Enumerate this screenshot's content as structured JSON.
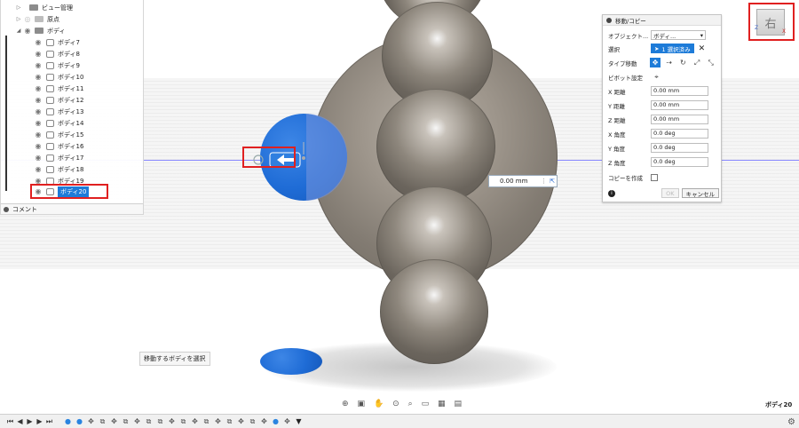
{
  "browser": {
    "view_manager": "ビュー管理",
    "origin": "原点",
    "bodies_folder": "ボディ",
    "bodies": [
      "ボディ7",
      "ボディ8",
      "ボディ9",
      "ボディ10",
      "ボディ11",
      "ボディ12",
      "ボディ13",
      "ボディ14",
      "ボディ15",
      "ボディ16",
      "ボディ17",
      "ボディ18",
      "ボディ19",
      "ボディ20"
    ],
    "selected_body": "ボディ20",
    "comment": "コメント"
  },
  "panel": {
    "title": "移動/コピー",
    "object_label": "オブジェクト...",
    "object_value": "ボディ...",
    "selection_label": "選択",
    "selection_value": "1 選択済み",
    "move_type_label": "タイプ移動",
    "pivot_label": "ピボット設定",
    "x_distance_label": "X 距離",
    "x_distance": "0.00 mm",
    "y_distance_label": "Y 距離",
    "y_distance": "0.00 mm",
    "z_distance_label": "Z 距離",
    "z_distance": "0.00 mm",
    "x_angle_label": "X 角度",
    "x_angle": "0.0 deg",
    "y_angle_label": "Y 角度",
    "y_angle": "0.0 deg",
    "z_angle_label": "Z 角度",
    "z_angle": "0.0 deg",
    "copy_label": "コピーを作成",
    "ok": "OK",
    "cancel": "キャンセル"
  },
  "viewport": {
    "distance_value": "0.00 mm",
    "status_tip": "移動するボディを選択",
    "active_body": "ボディ20",
    "viewcube_face": "右",
    "axis_z": "Z",
    "axis_x": "X"
  },
  "colors": {
    "selection_blue": "#1d7bd8",
    "highlight_red": "#e02020"
  },
  "icons": {
    "viewcube": "viewcube-icon",
    "settings": "gear-icon"
  }
}
